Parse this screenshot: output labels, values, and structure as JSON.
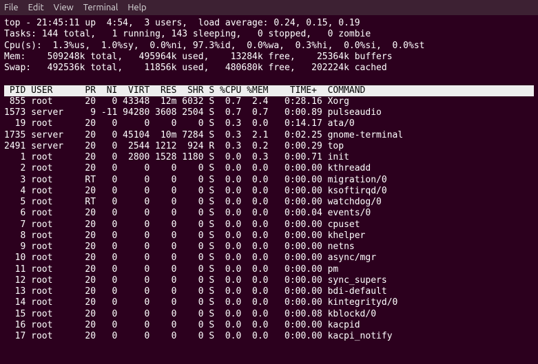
{
  "menu": {
    "file": "File",
    "edit": "Edit",
    "view": "View",
    "terminal": "Terminal",
    "help": "Help"
  },
  "summary": {
    "line1": "top - 21:45:11 up  4:54,  3 users,  load average: 0.24, 0.15, 0.19",
    "line2": "Tasks: 144 total,   1 running, 143 sleeping,   0 stopped,   0 zombie",
    "line3": "Cpu(s):  1.3%us,  1.0%sy,  0.0%ni, 97.3%id,  0.0%wa,  0.3%hi,  0.0%si,  0.0%st",
    "line4": "Mem:    509248k total,   495964k used,    13284k free,    25364k buffers",
    "line5": "Swap:   492536k total,    11856k used,   480680k free,   202224k cached"
  },
  "columns": " PID USER      PR  NI  VIRT  RES  SHR S %CPU %MEM    TIME+  COMMAND            ",
  "rows": [
    " 855 root      20   0 43348  12m 6032 S  0.7  2.4   0:28.16 Xorg",
    "1573 server     9 -11 94280 3608 2504 S  0.7  0.7   0:00.89 pulseaudio",
    "  19 root      20   0     0    0    0 S  0.3  0.0   0:14.17 ata/0",
    "1735 server    20   0 45104  10m 7284 S  0.3  2.1   0:02.25 gnome-terminal",
    "2491 server    20   0  2544 1212  924 R  0.3  0.2   0:00.29 top",
    "   1 root      20   0  2800 1528 1180 S  0.0  0.3   0:00.71 init",
    "   2 root      20   0     0    0    0 S  0.0  0.0   0:00.00 kthreadd",
    "   3 root      RT   0     0    0    0 S  0.0  0.0   0:00.00 migration/0",
    "   4 root      20   0     0    0    0 S  0.0  0.0   0:00.00 ksoftirqd/0",
    "   5 root      RT   0     0    0    0 S  0.0  0.0   0:00.00 watchdog/0",
    "   6 root      20   0     0    0    0 S  0.0  0.0   0:00.04 events/0",
    "   7 root      20   0     0    0    0 S  0.0  0.0   0:00.00 cpuset",
    "   8 root      20   0     0    0    0 S  0.0  0.0   0:00.00 khelper",
    "   9 root      20   0     0    0    0 S  0.0  0.0   0:00.00 netns",
    "  10 root      20   0     0    0    0 S  0.0  0.0   0:00.00 async/mgr",
    "  11 root      20   0     0    0    0 S  0.0  0.0   0:00.00 pm",
    "  12 root      20   0     0    0    0 S  0.0  0.0   0:00.00 sync_supers",
    "  13 root      20   0     0    0    0 S  0.0  0.0   0:00.00 bdi-default",
    "  14 root      20   0     0    0    0 S  0.0  0.0   0:00.00 kintegrityd/0",
    "  15 root      20   0     0    0    0 S  0.0  0.0   0:00.08 kblockd/0",
    "  16 root      20   0     0    0    0 S  0.0  0.0   0:00.00 kacpid",
    "  17 root      20   0     0    0    0 S  0.0  0.0   0:00.00 kacpi_notify"
  ]
}
